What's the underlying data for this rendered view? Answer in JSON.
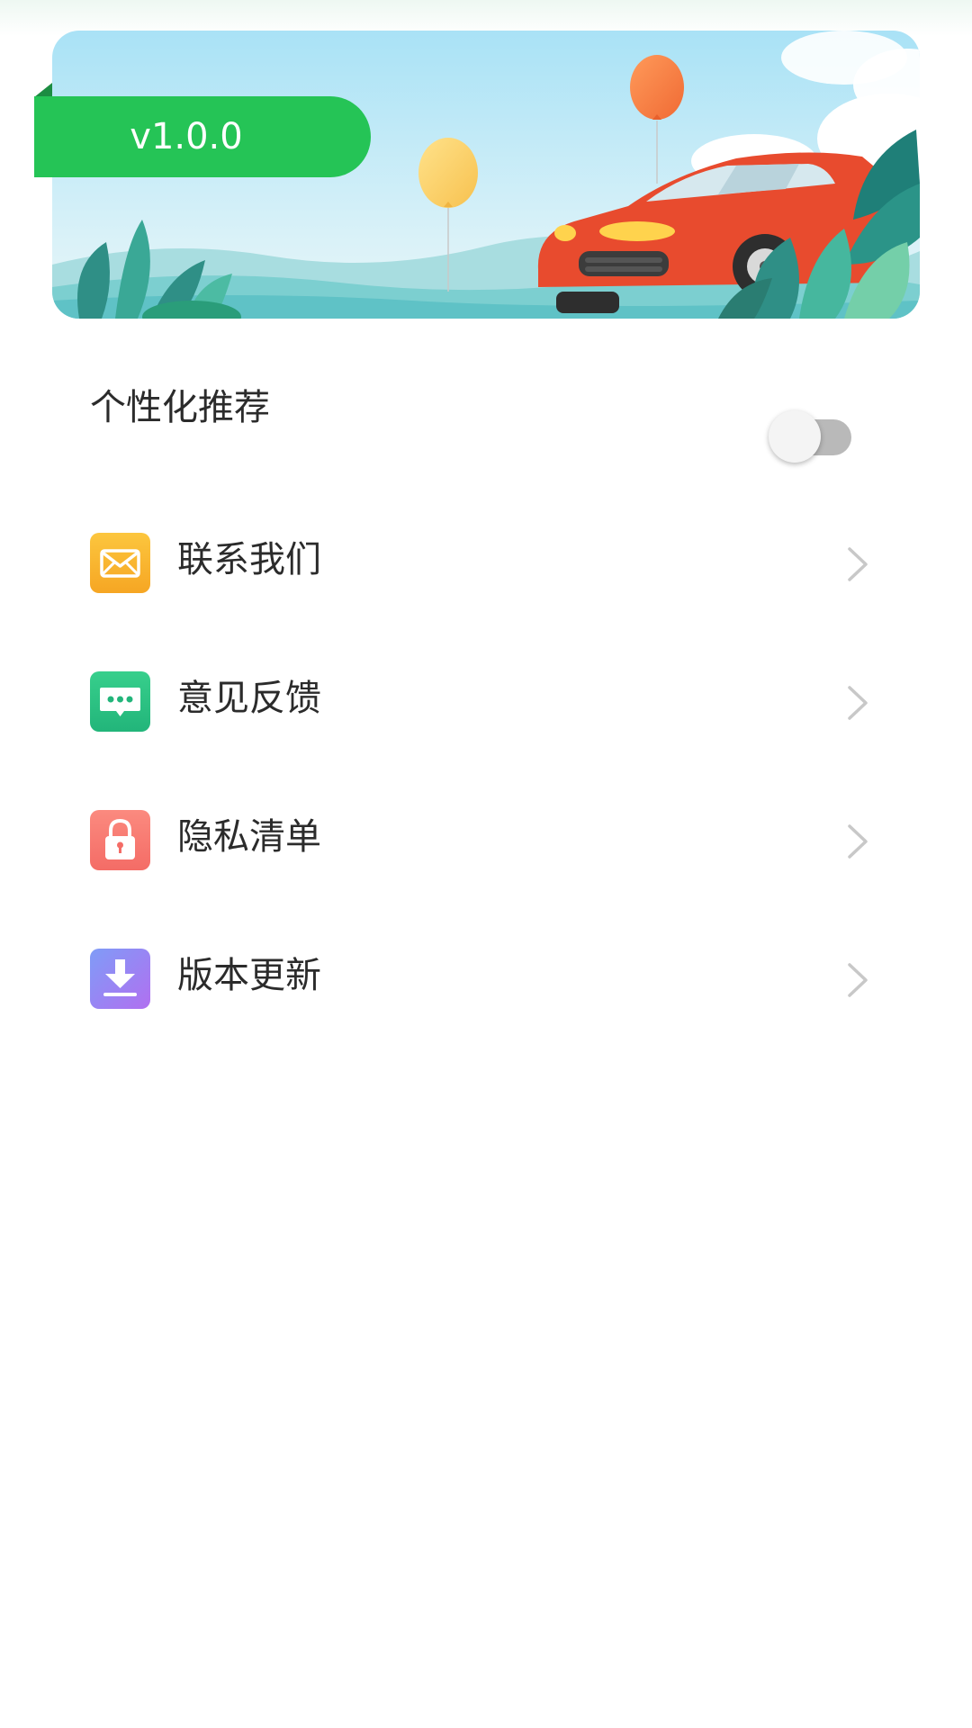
{
  "banner": {
    "version": "v1.0.0"
  },
  "settings": {
    "personalized_recommendation": {
      "label": "个性化推荐",
      "enabled": false
    }
  },
  "menu": {
    "items": [
      {
        "label": "联系我们",
        "icon": "mail-icon",
        "color": "#f9b52b"
      },
      {
        "label": "意见反馈",
        "icon": "chat-bubble-icon",
        "color": "#2cc284"
      },
      {
        "label": "隐私清单",
        "icon": "lock-icon",
        "color": "#f77b73"
      },
      {
        "label": "版本更新",
        "icon": "download-icon",
        "color": "#9b7cf0"
      }
    ]
  },
  "colors": {
    "accent_green": "#25c456",
    "text_primary": "#2b2b2b",
    "chevron_gray": "#c8c8c8"
  }
}
